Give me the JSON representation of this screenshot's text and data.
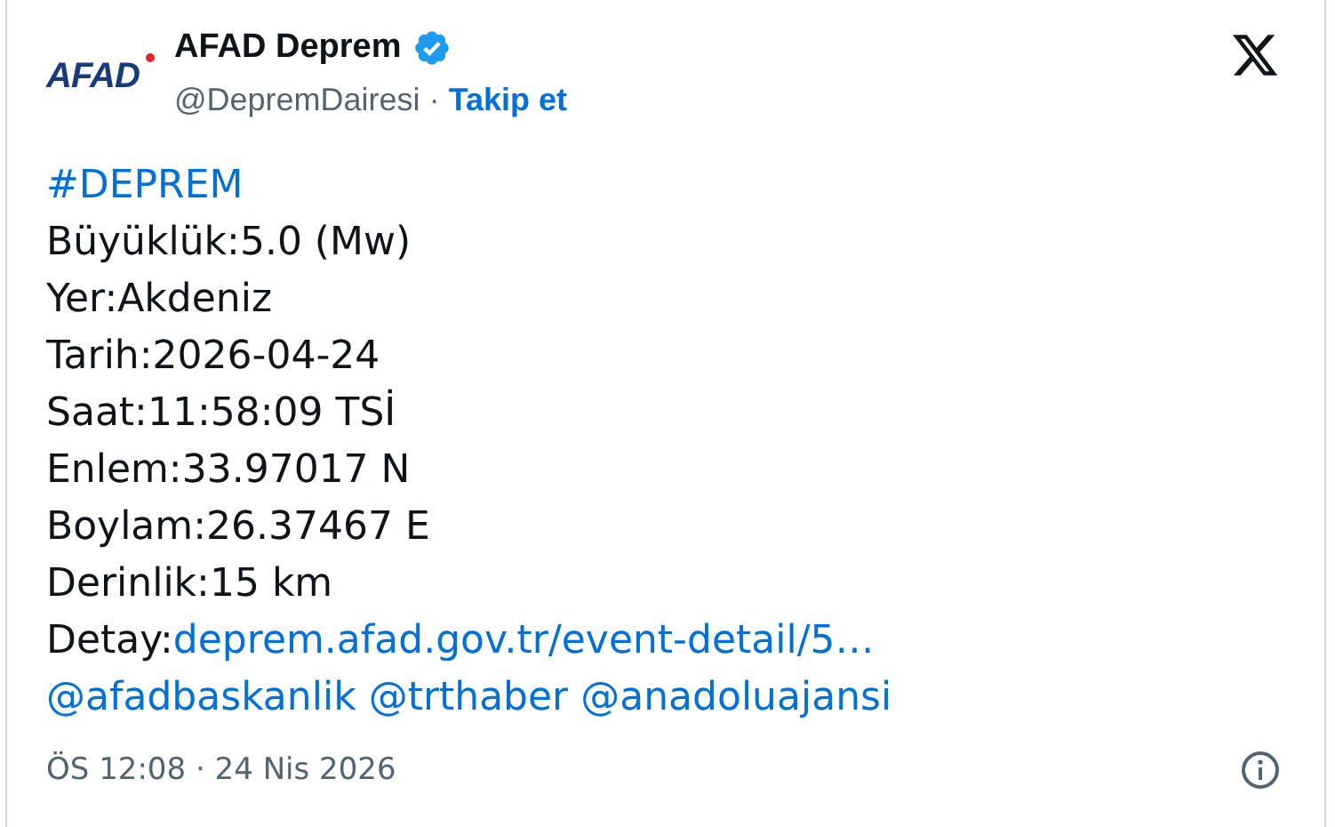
{
  "author": {
    "logo_text": "AFAD",
    "name": "AFAD Deprem",
    "verified": true,
    "handle": "@DepremDairesi",
    "separator": "·",
    "follow": "Takip et"
  },
  "body": [
    {
      "kind": "link",
      "text": "#DEPREM"
    },
    {
      "kind": "plain",
      "text": "Büyüklük:5.0 (Mw)"
    },
    {
      "kind": "plain",
      "text": "Yer:Akdeniz"
    },
    {
      "kind": "plain",
      "text": "Tarih:2026-04-24"
    },
    {
      "kind": "plain",
      "text": "Saat:11:58:09 TSİ"
    },
    {
      "kind": "plain",
      "text": "Enlem:33.97017 N"
    },
    {
      "kind": "plain",
      "text": "Boylam:26.37467 E"
    },
    {
      "kind": "plain",
      "text": "Derinlik:15 km"
    },
    {
      "kind": "labeled_link",
      "label": "Detay:",
      "text": "deprem.afad.gov.tr/event-detail/5…"
    },
    {
      "kind": "mentions",
      "items": [
        "@afadbaskanlik",
        "@trthaber",
        "@anadoluajansi"
      ]
    }
  ],
  "timestamp": "ÖS 12:08 · 24 Nis 2026"
}
